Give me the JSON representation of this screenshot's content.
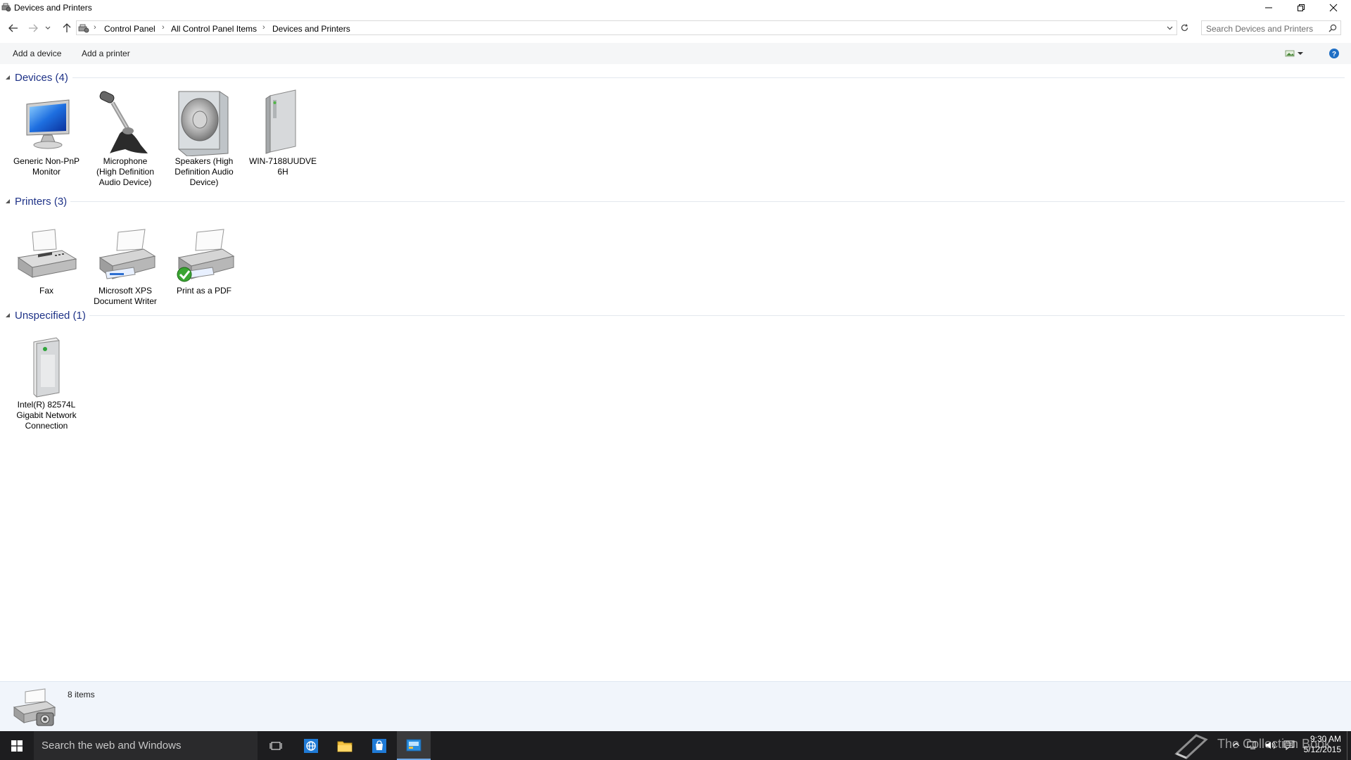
{
  "window": {
    "title": "Devices and Printers",
    "icons": {
      "app": "devices-printers-icon",
      "minimize": "minimize-icon",
      "restore": "restore-icon",
      "close": "close-icon"
    }
  },
  "nav": {
    "breadcrumb": [
      "Control Panel",
      "All Control Panel Items",
      "Devices and Printers"
    ],
    "search_placeholder": "Search Devices and Printers"
  },
  "commands": {
    "add_device": "Add a device",
    "add_printer": "Add a printer"
  },
  "groups": {
    "devices": {
      "title": "Devices (4)",
      "items": [
        {
          "label": "Generic Non-PnP\nMonitor",
          "icon": "monitor-icon"
        },
        {
          "label": "Microphone\n(High Definition\nAudio Device)",
          "icon": "microphone-icon"
        },
        {
          "label": "Speakers (High\nDefinition Audio\nDevice)",
          "icon": "speaker-icon"
        },
        {
          "label": "WIN-7188UUDVE\n6H",
          "icon": "computer-tower-icon"
        }
      ]
    },
    "printers": {
      "title": "Printers (3)",
      "items": [
        {
          "label": "Fax",
          "icon": "fax-icon"
        },
        {
          "label": "Microsoft XPS\nDocument Writer",
          "icon": "printer-icon"
        },
        {
          "label": "Print as a PDF",
          "icon": "printer-default-icon"
        }
      ]
    },
    "unspecified": {
      "title": "Unspecified (1)",
      "items": [
        {
          "label": "Intel(R) 82574L\nGigabit Network\nConnection",
          "icon": "network-device-icon"
        }
      ]
    }
  },
  "details": {
    "count": "8 items"
  },
  "taskbar": {
    "search": "Search the web and Windows",
    "watermark": "The Collection Book",
    "time": "9:30 AM",
    "date": "5/12/2015"
  },
  "colors": {
    "group_title": "#1e3287",
    "taskbar": "#1d1d1f",
    "details_pane": "#f1f5fb",
    "accent": "#0078d7"
  }
}
